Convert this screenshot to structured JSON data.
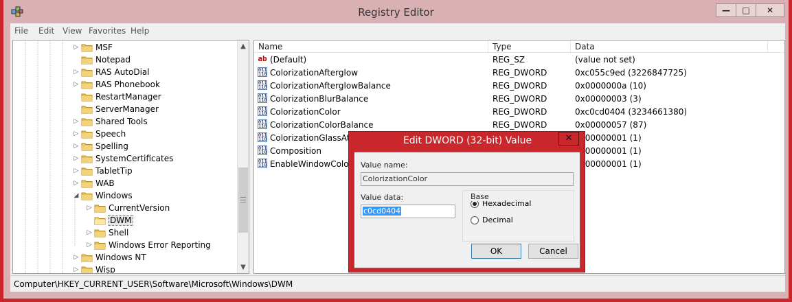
{
  "window": {
    "title": "Registry Editor",
    "minimize_glyph": "—",
    "maximize_glyph": "□",
    "close_glyph": "✕"
  },
  "menu": [
    "File",
    "Edit",
    "View",
    "Favorites",
    "Help"
  ],
  "tree": {
    "items": [
      {
        "label": "MSF",
        "arrow": "▷",
        "selected": false
      },
      {
        "label": "Notepad",
        "arrow": "",
        "selected": false
      },
      {
        "label": "RAS AutoDial",
        "arrow": "▷",
        "selected": false
      },
      {
        "label": "RAS Phonebook",
        "arrow": "▷",
        "selected": false
      },
      {
        "label": "RestartManager",
        "arrow": "",
        "selected": false
      },
      {
        "label": "ServerManager",
        "arrow": "",
        "selected": false
      },
      {
        "label": "Shared Tools",
        "arrow": "▷",
        "selected": false
      },
      {
        "label": "Speech",
        "arrow": "▷",
        "selected": false
      },
      {
        "label": "Spelling",
        "arrow": "▷",
        "selected": false
      },
      {
        "label": "SystemCertificates",
        "arrow": "▷",
        "selected": false
      },
      {
        "label": "TabletTip",
        "arrow": "▷",
        "selected": false
      },
      {
        "label": "WAB",
        "arrow": "▷",
        "selected": false
      },
      {
        "label": "Windows",
        "arrow": "◢",
        "selected": false
      },
      {
        "label": "CurrentVersion",
        "arrow": "▷",
        "selected": false
      },
      {
        "label": "DWM",
        "arrow": "",
        "selected": true
      },
      {
        "label": "Shell",
        "arrow": "▷",
        "selected": false
      },
      {
        "label": "Windows Error Reporting",
        "arrow": "▷",
        "selected": false
      },
      {
        "label": "Windows NT",
        "arrow": "▷",
        "selected": false
      },
      {
        "label": "Wisp",
        "arrow": "▷",
        "selected": false
      }
    ]
  },
  "list": {
    "columns": [
      "Name",
      "Type",
      "Data"
    ],
    "rows": [
      {
        "name": "(Default)",
        "type": "REG_SZ",
        "data": "(value not set)",
        "icon": "string-value-icon"
      },
      {
        "name": "ColorizationAfterglow",
        "type": "REG_DWORD",
        "data": "0xc055c9ed (3226847725)",
        "icon": "dword-value-icon"
      },
      {
        "name": "ColorizationAfterglowBalance",
        "type": "REG_DWORD",
        "data": "0x0000000a (10)",
        "icon": "dword-value-icon"
      },
      {
        "name": "ColorizationBlurBalance",
        "type": "REG_DWORD",
        "data": "0x00000003 (3)",
        "icon": "dword-value-icon"
      },
      {
        "name": "ColorizationColor",
        "type": "REG_DWORD",
        "data": "0xc0cd0404 (3234661380)",
        "icon": "dword-value-icon"
      },
      {
        "name": "ColorizationColorBalance",
        "type": "REG_DWORD",
        "data": "0x00000057 (87)",
        "icon": "dword-value-icon"
      },
      {
        "name": "ColorizationGlassAttrib",
        "type": "",
        "data": "0x00000001 (1)",
        "icon": "dword-value-icon"
      },
      {
        "name": "Composition",
        "type": "",
        "data": "0x00000001 (1)",
        "icon": "dword-value-icon"
      },
      {
        "name": "EnableWindowColoriza",
        "type": "",
        "data": "0x00000001 (1)",
        "icon": "dword-value-icon"
      }
    ]
  },
  "status": {
    "path": "Computer\\HKEY_CURRENT_USER\\Software\\Microsoft\\Windows\\DWM"
  },
  "dialog": {
    "title": "Edit DWORD (32-bit) Value",
    "close_glyph": "✕",
    "value_name_label": "Value name:",
    "value_name": "ColorizationColor",
    "value_data_label": "Value data:",
    "value_data": "c0cd0404",
    "base_label": "Base",
    "hex_label": "Hexadecimal",
    "dec_label": "Decimal",
    "selected_base": "Hexadecimal",
    "ok_label": "OK",
    "cancel_label": "Cancel"
  },
  "colors": {
    "accent": "#c9272b",
    "titlebar": "#d9b0b3",
    "selection": "#3399ff"
  }
}
